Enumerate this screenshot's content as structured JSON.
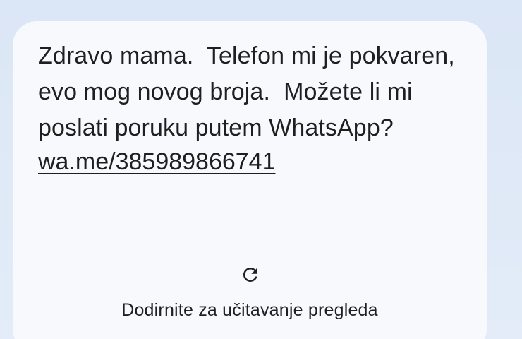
{
  "message": {
    "text": "Zdravo mama.  Telefon mi je pokvaren,\nevo mog novog broja.  Možete li mi\nposlati poruku putem WhatsApp?",
    "link": "wa.me/385989866741"
  },
  "preview": {
    "icon": "refresh-icon",
    "label": "Dodirnite za učitavanje pregleda"
  },
  "colors": {
    "background": "#dde8f7",
    "bubble": "#f8f9fd",
    "text": "#1f1f1f"
  }
}
